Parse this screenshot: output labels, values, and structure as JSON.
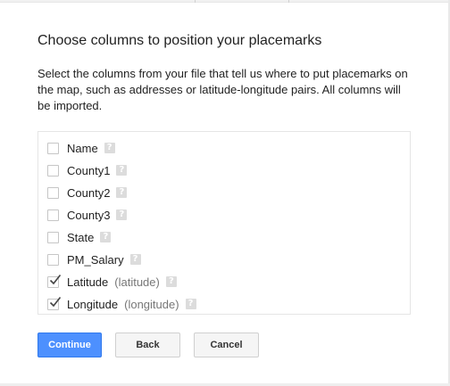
{
  "dialog": {
    "title": "Choose columns to position your placemarks",
    "description": "Select the columns from your file that tell us where to put placemarks on the map, such as addresses or latitude-longitude pairs. All columns will be imported."
  },
  "columns": [
    {
      "label": "Name",
      "type": "",
      "checked": false,
      "help_icon": "help-icon"
    },
    {
      "label": "County1",
      "type": "",
      "checked": false,
      "help_icon": "help-icon"
    },
    {
      "label": "County2",
      "type": "",
      "checked": false,
      "help_icon": "help-icon"
    },
    {
      "label": "County3",
      "type": "",
      "checked": false,
      "help_icon": "help-icon"
    },
    {
      "label": "State",
      "type": "",
      "checked": false,
      "help_icon": "help-icon"
    },
    {
      "label": "PM_Salary",
      "type": "",
      "checked": false,
      "help_icon": "help-icon"
    },
    {
      "label": "Latitude",
      "type": "(latitude)",
      "checked": true,
      "help_icon": "help-icon"
    },
    {
      "label": "Longitude",
      "type": "(longitude)",
      "checked": true,
      "help_icon": "help-icon"
    }
  ],
  "help_glyph": "?",
  "buttons": {
    "continue_label": "Continue",
    "back_label": "Back",
    "cancel_label": "Cancel"
  },
  "colors": {
    "primary_button": "#4d90fe",
    "secondary_button": "#f5f5f5",
    "checkmark": "#444444",
    "help_icon": "#dcdcdc"
  }
}
